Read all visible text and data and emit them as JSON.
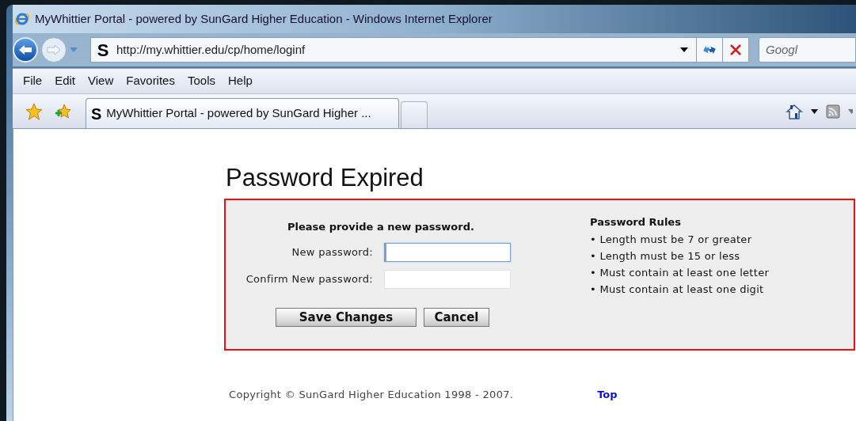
{
  "window": {
    "title": "MyWhittier Portal - powered by SunGard Higher Education - Windows Internet Explorer"
  },
  "address_bar": {
    "logo": "S",
    "url": "http://my.whittier.edu/cp/home/loginf"
  },
  "search": {
    "placeholder": "Googl"
  },
  "menu": [
    "File",
    "Edit",
    "View",
    "Favorites",
    "Tools",
    "Help"
  ],
  "tabs": [
    {
      "logo": "S",
      "label": "MyWhittier Portal - powered by SunGard Higher ...",
      "selected": true
    },
    {
      "selected": false
    }
  ],
  "page": {
    "heading": "Password Expired",
    "instruction": "Please provide a new password.",
    "fields": [
      {
        "label": "New password:",
        "focused": true
      },
      {
        "label": "Confirm New password:",
        "focused": false
      }
    ],
    "buttons": [
      "Save Changes",
      "Cancel"
    ],
    "rules_title": "Password Rules",
    "rules": [
      "• Length must be 7 or greater",
      "• Length must be 15 or less",
      "• Must contain at least one letter",
      "• Must contain at least one digit"
    ],
    "copyright": "Copyright © SunGard Higher Education 1998 - 2007.",
    "top_link": "Top"
  }
}
